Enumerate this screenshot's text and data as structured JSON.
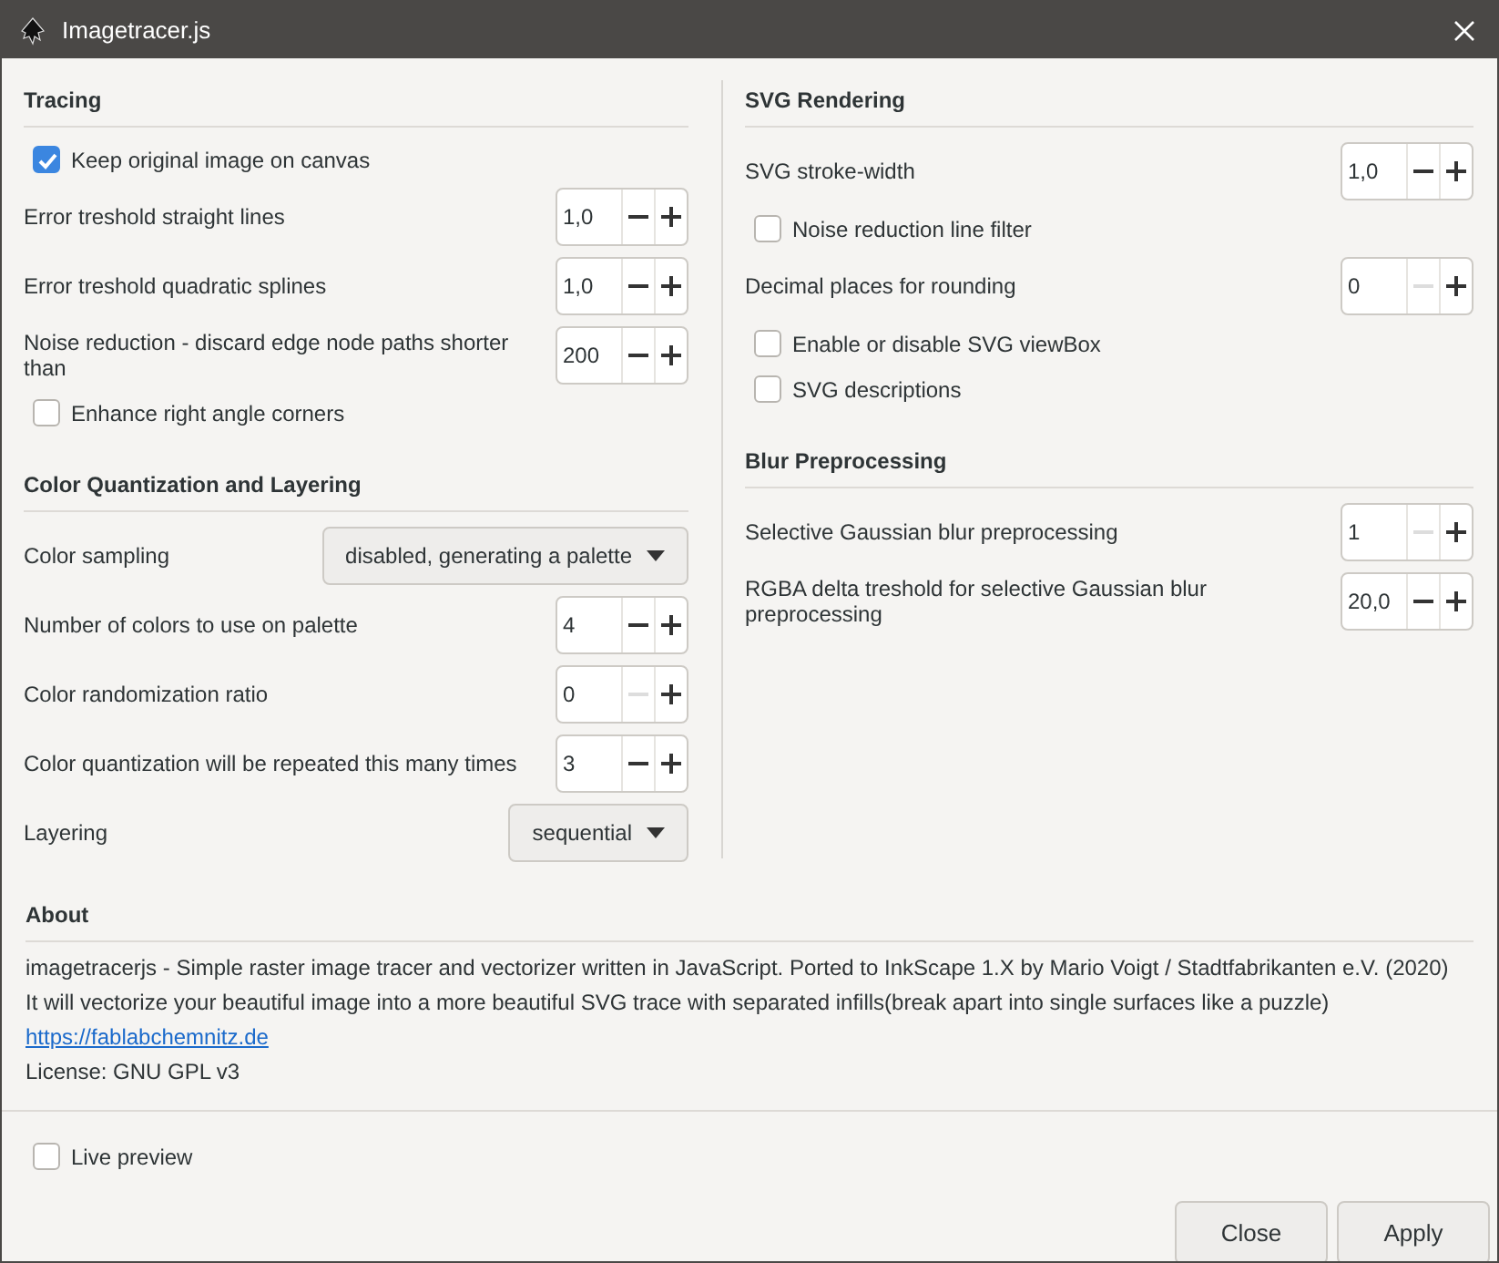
{
  "window": {
    "title": "Imagetracer.js"
  },
  "columns": [
    [
      {
        "heading": "Tracing",
        "items": [
          {
            "kind": "checkbox",
            "label": "Keep original image on canvas",
            "checked": true
          },
          {
            "kind": "spin",
            "label": "Error treshold straight lines",
            "value": "1,0",
            "decrease_disabled": false
          },
          {
            "kind": "spin",
            "label": "Error treshold quadratic splines",
            "value": "1,0",
            "decrease_disabled": false
          },
          {
            "kind": "spin",
            "label": "Noise reduction - discard edge node paths shorter than",
            "value": "200",
            "decrease_disabled": false
          },
          {
            "kind": "checkbox",
            "label": "Enhance right angle corners",
            "checked": false
          }
        ]
      },
      {
        "heading": "Color Quantization and Layering",
        "items": [
          {
            "kind": "dropdown",
            "label": "Color sampling",
            "value": "disabled, generating a palette"
          },
          {
            "kind": "spin",
            "label": "Number of colors to use on palette",
            "value": "4",
            "decrease_disabled": false
          },
          {
            "kind": "spin",
            "label": "Color randomization ratio",
            "value": "0",
            "decrease_disabled": true
          },
          {
            "kind": "spin",
            "label": "Color quantization will be repeated this many times",
            "value": "3",
            "decrease_disabled": false
          },
          {
            "kind": "dropdown",
            "label": "Layering",
            "value": "sequential"
          }
        ]
      }
    ],
    [
      {
        "heading": "SVG Rendering",
        "items": [
          {
            "kind": "spin",
            "label": "SVG stroke-width",
            "value": "1,0",
            "decrease_disabled": false
          },
          {
            "kind": "checkbox",
            "label": "Noise reduction line filter",
            "checked": false
          },
          {
            "kind": "spin",
            "label": "Decimal places for rounding",
            "value": "0",
            "decrease_disabled": true
          },
          {
            "kind": "checkbox",
            "label": "Enable or disable SVG viewBox",
            "checked": false
          },
          {
            "kind": "checkbox",
            "label": "SVG descriptions",
            "checked": false
          }
        ]
      },
      {
        "heading": "Blur Preprocessing",
        "items": [
          {
            "kind": "spin",
            "label": "Selective Gaussian blur preprocessing",
            "value": "1",
            "decrease_disabled": true
          },
          {
            "kind": "spin",
            "label": "RGBA delta treshold for selective Gaussian blur preprocessing",
            "value": "20,0",
            "decrease_disabled": false
          }
        ]
      }
    ]
  ],
  "about": {
    "heading": "About",
    "lines": [
      {
        "kind": "text",
        "text": "imagetracerjs - Simple raster image tracer and vectorizer written in JavaScript. Ported to InkScape 1.X by Mario Voigt / Stadtfabrikanten e.V. (2020)"
      },
      {
        "kind": "text",
        "text": "It will vectorize your beautiful image into a more beautiful SVG trace with separated infills(break apart into single surfaces like a puzzle)"
      },
      {
        "kind": "link",
        "text": "https://fablabchemnitz.de"
      },
      {
        "kind": "text",
        "text": "License: GNU GPL v3"
      }
    ]
  },
  "live_preview": {
    "label": "Live preview",
    "checked": false
  },
  "buttons": [
    "Close",
    "Apply"
  ]
}
